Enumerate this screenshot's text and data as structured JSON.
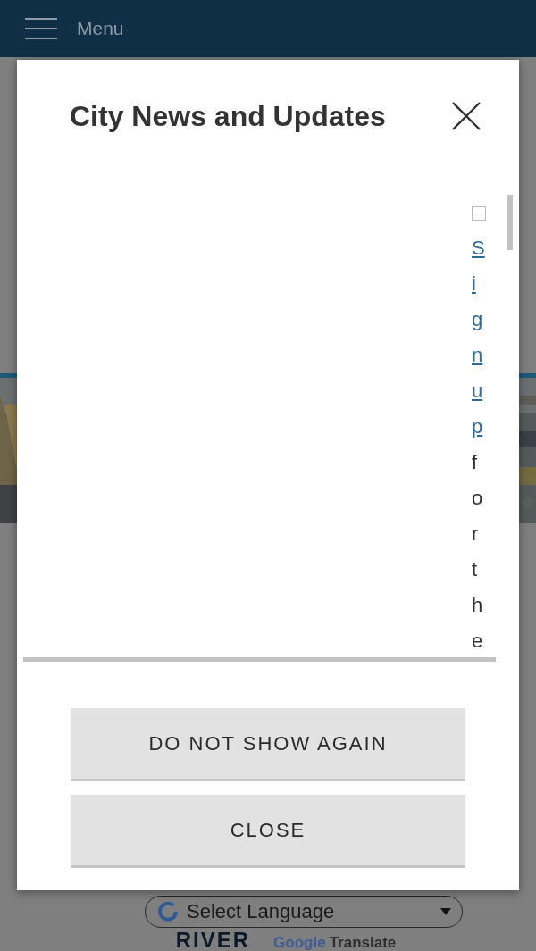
{
  "header": {
    "menu_label": "Menu"
  },
  "modal": {
    "title": "City News and Updates",
    "subscribe_checked": false,
    "signup_link": "Sign up",
    "signup_text": "for the",
    "buttons": [
      {
        "label": "DO NOT SHOW AGAIN"
      },
      {
        "label": "CLOSE"
      }
    ]
  },
  "background": {
    "language_select": {
      "value": "Select Language"
    },
    "translate_brand": "Google",
    "translate_label": "Translate",
    "logo": "RIVER"
  }
}
